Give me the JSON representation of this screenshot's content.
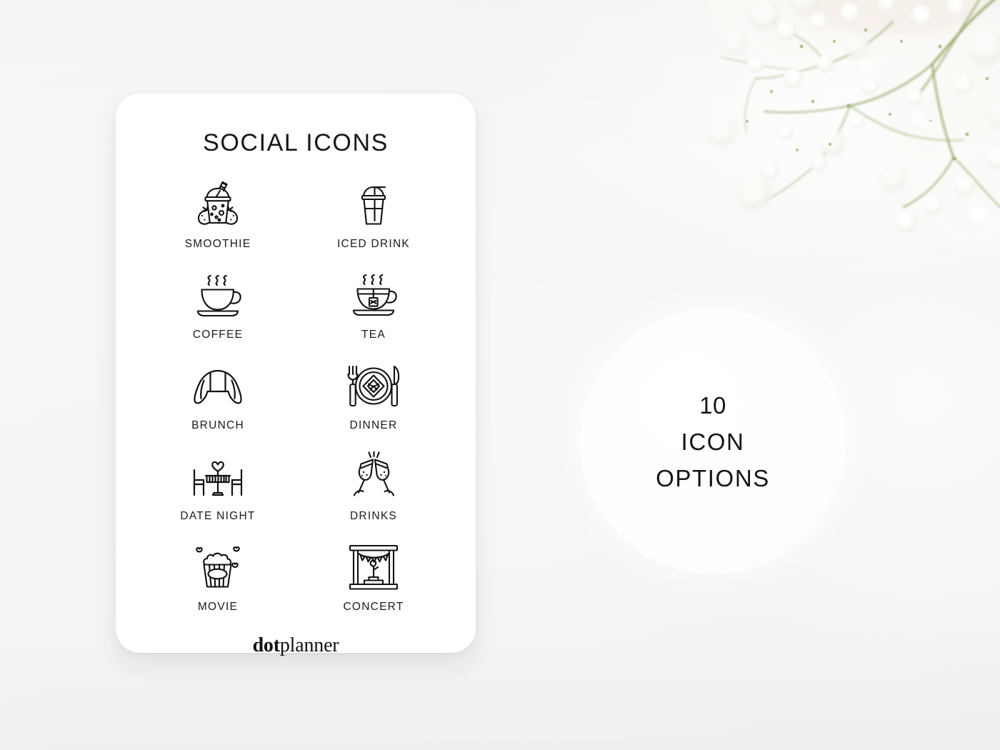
{
  "background": {
    "base_color": "#f7f6f4",
    "decoration": "babys-breath-flowers-top-right"
  },
  "card": {
    "title": "SOCIAL ICONS",
    "brand": {
      "bold_part": "dot",
      "light_part": "planner"
    },
    "icons": [
      {
        "id": "smoothie",
        "label": "SMOOTHIE",
        "icon_name": "smoothie-cup-icon"
      },
      {
        "id": "iced-drink",
        "label": "ICED DRINK",
        "icon_name": "iced-drink-cup-icon"
      },
      {
        "id": "coffee",
        "label": "COFFEE",
        "icon_name": "coffee-cup-icon"
      },
      {
        "id": "tea",
        "label": "TEA",
        "icon_name": "tea-cup-icon"
      },
      {
        "id": "brunch",
        "label": "BRUNCH",
        "icon_name": "croissant-icon"
      },
      {
        "id": "dinner",
        "label": "DINNER",
        "icon_name": "plate-cutlery-icon"
      },
      {
        "id": "date-night",
        "label": "DATE NIGHT",
        "icon_name": "table-chairs-heart-icon"
      },
      {
        "id": "drinks",
        "label": "DRINKS",
        "icon_name": "champagne-toast-icon"
      },
      {
        "id": "movie",
        "label": "MOVIE",
        "icon_name": "popcorn-icon"
      },
      {
        "id": "concert",
        "label": "CONCERT",
        "icon_name": "stage-microphone-icon"
      }
    ]
  },
  "badge": {
    "count": "10",
    "word1": "ICON",
    "word2": "OPTIONS"
  },
  "colors": {
    "ink": "#17181a",
    "card": "#ffffff",
    "background": "#f7f6f4"
  }
}
